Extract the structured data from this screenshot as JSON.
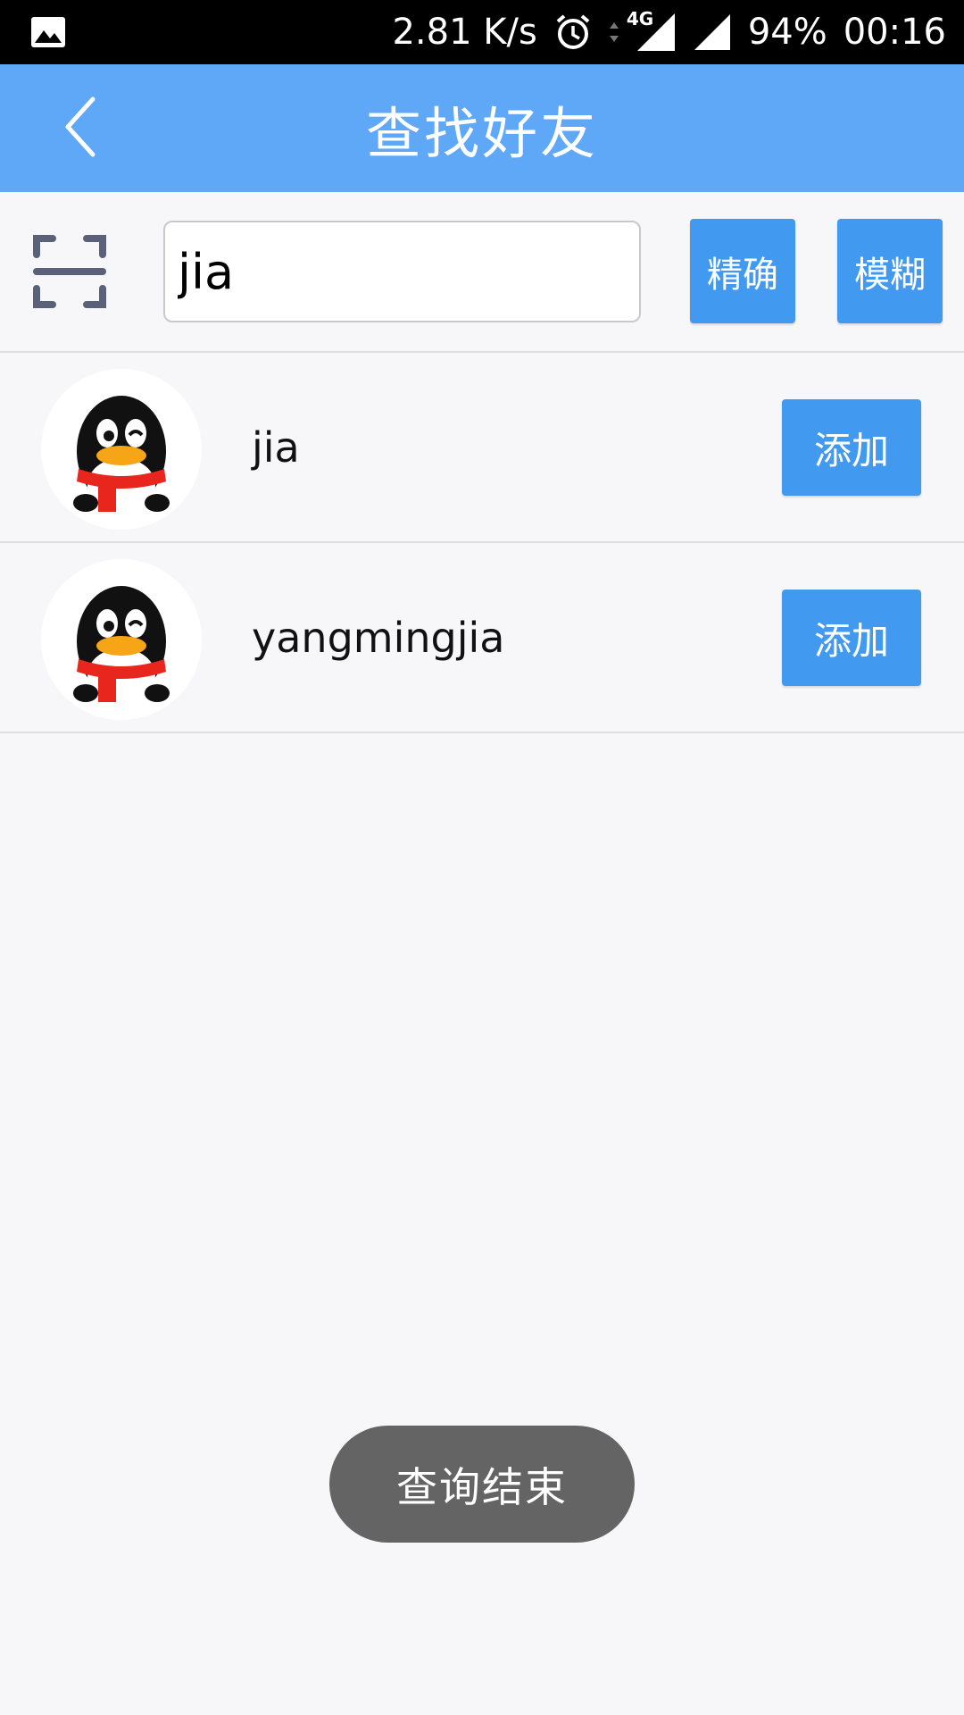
{
  "status_bar": {
    "speed": "2.81 K/s",
    "network": "4G",
    "battery": "94%",
    "time": "00:16",
    "icons": [
      "image-icon",
      "alarm-icon",
      "data-arrows-icon",
      "signal-4g-icon",
      "signal-icon"
    ]
  },
  "header": {
    "title": "查找好友",
    "back_icon": "chevron-left-icon",
    "background": "#5ea8f7"
  },
  "search": {
    "scan_icon": "scan-icon",
    "value": "jia",
    "exact_label": "精确",
    "fuzzy_label": "模糊",
    "button_color": "#4299f0"
  },
  "results": [
    {
      "name": "jia",
      "add_label": "添加",
      "avatar_icon": "penguin-avatar-icon"
    },
    {
      "name": "yangmingjia",
      "add_label": "添加",
      "avatar_icon": "penguin-avatar-icon"
    }
  ],
  "toast": {
    "text": "查询结束"
  }
}
